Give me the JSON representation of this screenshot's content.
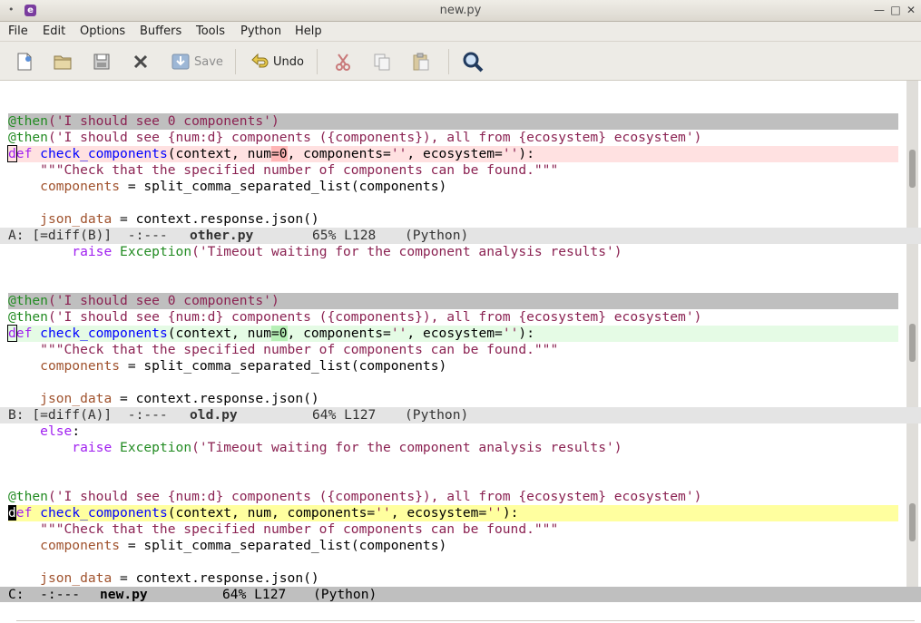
{
  "window": {
    "title": "new.py",
    "system_menu_glyph": "•",
    "app_icon_glyph": "e",
    "minimize_glyph": "—",
    "maximize_glyph": "□",
    "close_glyph": "✕"
  },
  "menu": [
    "File",
    "Edit",
    "Options",
    "Buffers",
    "Tools",
    "Python",
    "Help"
  ],
  "toolbar": {
    "save_label": "Save",
    "undo_label": "Undo"
  },
  "pane_a": {
    "lines": {
      "deco0": "@then",
      "str0": "('I should see 0 components')",
      "deco1": "@then",
      "str1": "('I should see {num:d} components ({components}), all from {ecosystem} ecosystem')",
      "def_first": "d",
      "def_rest": "ef",
      "fn_name": "check_components",
      "sig_pre": "(context, num",
      "sig_eq": "=0",
      "sig_post": ", components=",
      "sig_str1": "''",
      "sig_mid": ", ecosystem=",
      "sig_str2": "''",
      "sig_end": "):",
      "doc": "    \"\"\"Check that the specified number of components can be found.\"\"\"",
      "var_name": "components",
      "assign": " = split_comma_separated_list(components)",
      "json_var": "json_data",
      "json_rest": " = context.response.json()"
    },
    "modeline": {
      "prefix": "A: [=diff(B)]  -:---  ",
      "buffer": "other.py",
      "position": "65% L128",
      "mode": "(Python)"
    }
  },
  "pane_b": {
    "lines": {
      "raise_kw": "raise",
      "exc": "Exception",
      "raise_str": "('Timeout waiting for the component analysis results')",
      "deco0": "@then",
      "str0": "('I should see 0 components')",
      "deco1": "@then",
      "str1": "('I should see {num:d} components ({components}), all from {ecosystem} ecosystem')",
      "def_first": "d",
      "def_rest": "ef",
      "fn_name": "check_components",
      "sig_pre": "(context, num",
      "sig_eq": "=0",
      "sig_post": ", components=",
      "sig_str1": "''",
      "sig_mid": ", ecosystem=",
      "sig_str2": "''",
      "sig_end": "):",
      "doc": "    \"\"\"Check that the specified number of components can be found.\"\"\"",
      "var_name": "components",
      "assign": " = split_comma_separated_list(components)",
      "json_var": "json_data",
      "json_rest": " = context.response.json()"
    },
    "modeline": {
      "prefix": "B: [=diff(A)]  -:---  ",
      "buffer": "old.py",
      "position": "64% L127",
      "mode": "(Python)"
    }
  },
  "pane_c": {
    "lines": {
      "else_kw": "else",
      "colon": ":",
      "raise_kw": "raise",
      "exc": "Exception",
      "raise_str": "('Timeout waiting for the component analysis results')",
      "deco1": "@then",
      "str1": "('I should see {num:d} components ({components}), all from {ecosystem} ecosystem')",
      "def_first": "d",
      "def_rest": "ef",
      "fn_name": "check_components",
      "sig_pre": "(context, num, components=",
      "sig_str1": "''",
      "sig_mid": ", ecosystem=",
      "sig_str2": "''",
      "sig_end": "):",
      "doc": "    \"\"\"Check that the specified number of components can be found.\"\"\"",
      "var_name": "components",
      "assign": " = split_comma_separated_list(components)",
      "json_var": "json_data",
      "json_rest": " = context.response.json()"
    },
    "modeline": {
      "prefix": "C:  -:---  ",
      "buffer": "new.py",
      "position": "64% L127",
      "mode": "(Python)"
    }
  },
  "colors": {
    "diff_removed": "#ffb6b6",
    "diff_added": "#b6f0b6",
    "current_line": "#ffff9f",
    "header_fill": "#bfbfbf"
  }
}
